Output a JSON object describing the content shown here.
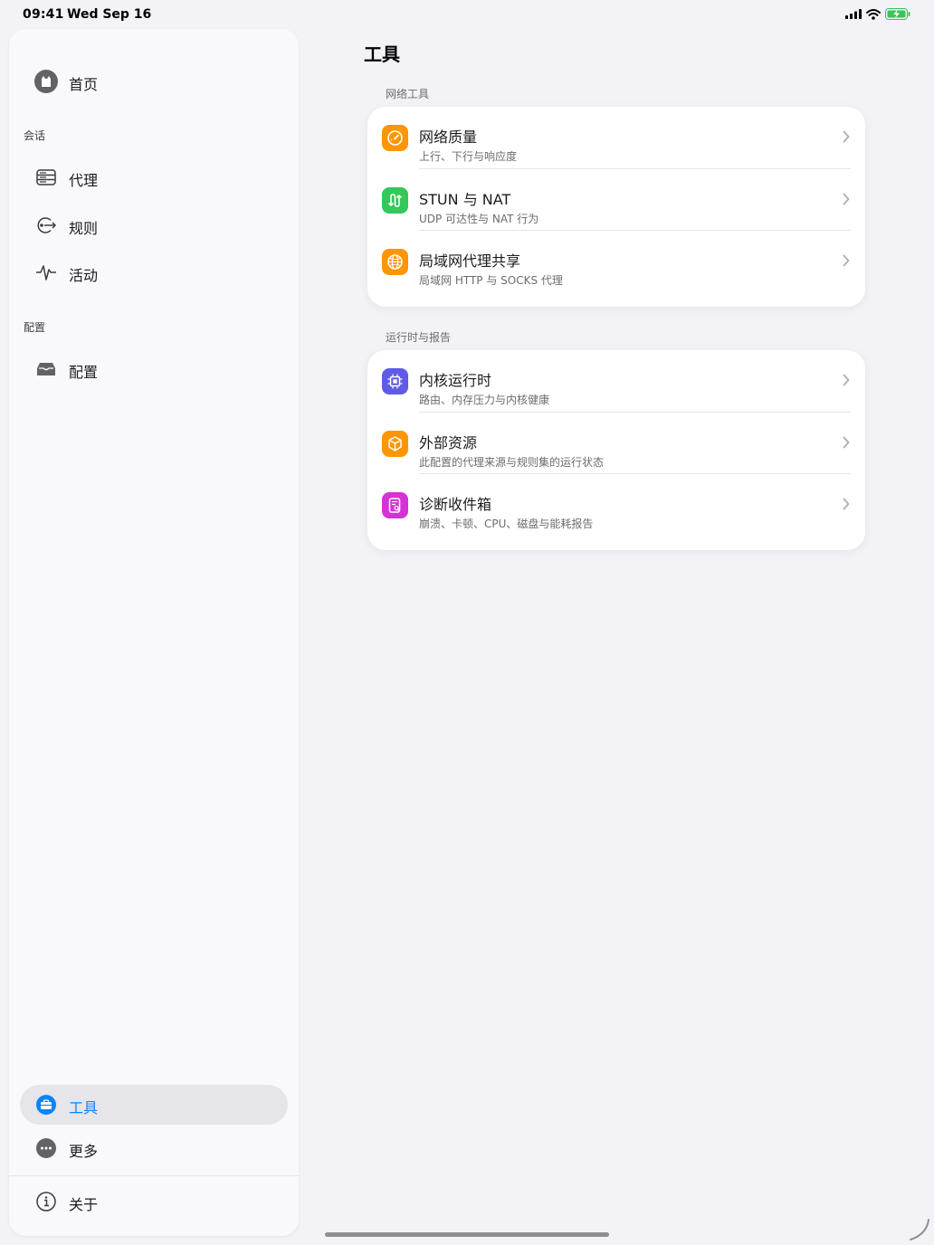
{
  "status_bar": {
    "time": "09:41",
    "date": "Wed Sep 16"
  },
  "sidebar": {
    "home_label": "首页",
    "section_session": "会话",
    "proxy_label": "代理",
    "rules_label": "规则",
    "activity_label": "活动",
    "section_config": "配置",
    "config_label": "配置",
    "tools_label": "工具",
    "more_label": "更多",
    "about_label": "关于"
  },
  "main": {
    "title": "工具",
    "groups": [
      {
        "label": "网络工具",
        "rows": [
          {
            "title": "网络质量",
            "subtitle": "上行、下行与响应度",
            "icon": "speedometer-icon",
            "color": "#ff9500"
          },
          {
            "title": "STUN 与 NAT",
            "subtitle": "UDP 可达性与 NAT 行为",
            "icon": "nat-arrows-icon",
            "color": "#34c759"
          },
          {
            "title": "局域网代理共享",
            "subtitle": "局域网 HTTP 与 SOCKS 代理",
            "icon": "globe-icon",
            "color": "#ff9500"
          }
        ]
      },
      {
        "label": "运行时与报告",
        "rows": [
          {
            "title": "内核运行时",
            "subtitle": "路由、内存压力与内核健康",
            "icon": "cpu-icon",
            "color": "#5e5ce6"
          },
          {
            "title": "外部资源",
            "subtitle": "此配置的代理来源与规则集的运行状态",
            "icon": "cube-icon",
            "color": "#ff9500"
          },
          {
            "title": "诊断收件箱",
            "subtitle": "崩溃、卡顿、CPU、磁盘与能耗报告",
            "icon": "report-icon",
            "color": "#d633d6"
          }
        ]
      }
    ]
  },
  "colors": {
    "accent": "#0a84ff",
    "background": "#f2f2f7",
    "battery": "#34c759"
  }
}
